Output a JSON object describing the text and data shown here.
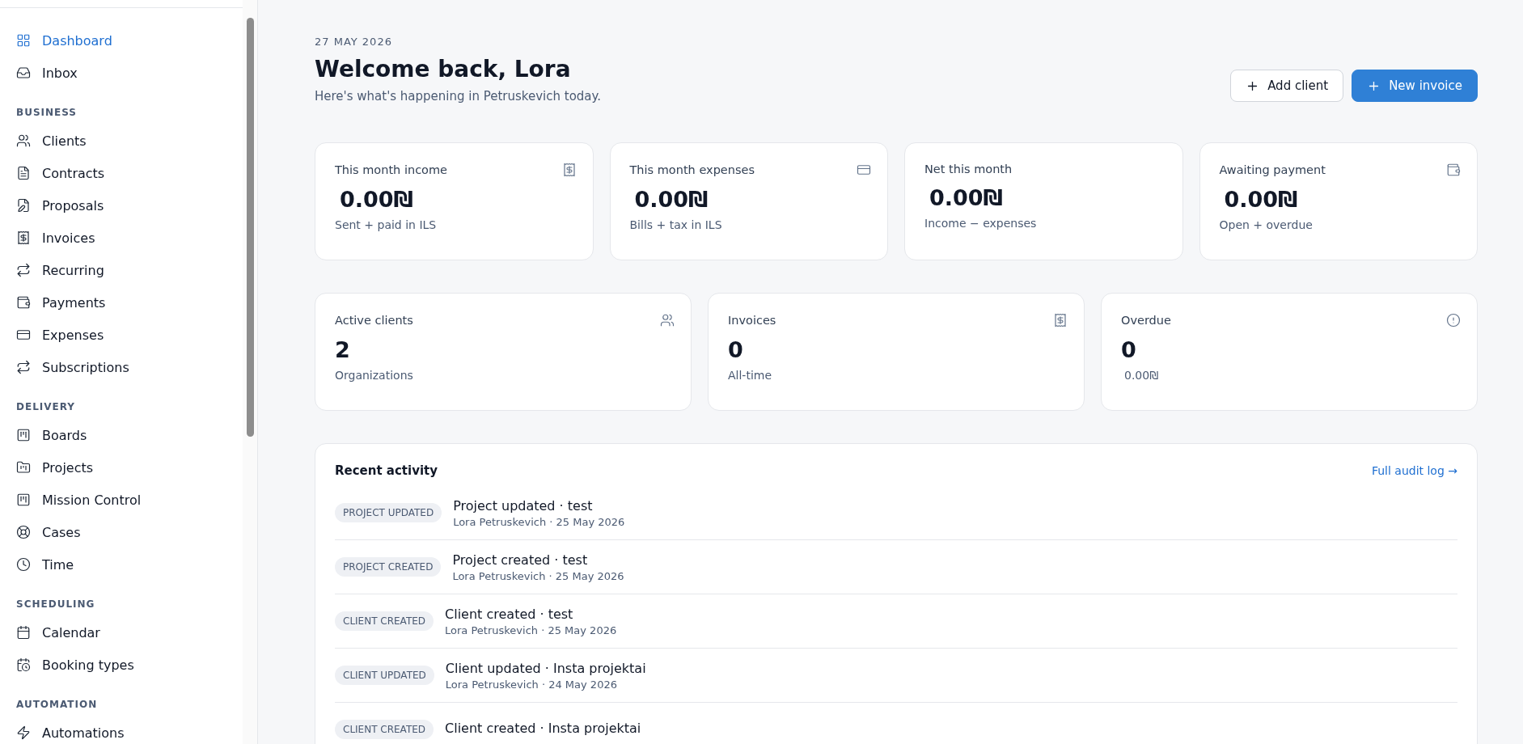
{
  "sidebar": {
    "sections": [
      {
        "items": [
          {
            "label": "Dashboard",
            "selected": true
          },
          {
            "label": "Inbox",
            "selected": false
          }
        ]
      },
      {
        "title": "BUSINESS",
        "items": [
          {
            "label": "Clients",
            "selected": false
          },
          {
            "label": "Contracts",
            "selected": false
          },
          {
            "label": "Proposals",
            "selected": false
          },
          {
            "label": "Invoices",
            "selected": false
          },
          {
            "label": "Recurring",
            "selected": false
          },
          {
            "label": "Payments",
            "selected": false
          },
          {
            "label": "Expenses",
            "selected": false
          },
          {
            "label": "Subscriptions",
            "selected": false
          }
        ]
      },
      {
        "title": "DELIVERY",
        "items": [
          {
            "label": "Boards",
            "selected": false
          },
          {
            "label": "Projects",
            "selected": false
          },
          {
            "label": "Mission Control",
            "selected": false
          },
          {
            "label": "Cases",
            "selected": false
          },
          {
            "label": "Time",
            "selected": false
          }
        ]
      },
      {
        "title": "SCHEDULING",
        "items": [
          {
            "label": "Calendar",
            "selected": false
          },
          {
            "label": "Booking types",
            "selected": false
          }
        ]
      },
      {
        "title": "AUTOMATION",
        "items": [
          {
            "label": "Automations",
            "selected": false
          }
        ]
      }
    ]
  },
  "header": {
    "date": "27 MAY 2026",
    "title": "Welcome back, Lora",
    "subtitle": "Here's what's happening in Petruskevich today.",
    "buttons": [
      {
        "label": "Add client",
        "kind": "secondary"
      },
      {
        "label": "New invoice",
        "kind": "primary"
      }
    ]
  },
  "money_cards": [
    {
      "label": "This month income",
      "value": "0.00₪",
      "note": "Sent + paid in ILS"
    },
    {
      "label": "This month expenses",
      "value": "0.00₪",
      "note": "Bills + tax in ILS"
    },
    {
      "label": "Net this month",
      "value": "0.00₪",
      "note": "Income − expenses"
    },
    {
      "label": "Awaiting payment",
      "value": "0.00₪",
      "note": "Open + overdue"
    }
  ],
  "count_cards": [
    {
      "label": "Active clients",
      "value": "2",
      "note": "Organizations"
    },
    {
      "label": "Invoices",
      "value": "0",
      "note": "All-time"
    },
    {
      "label": "Overdue",
      "value": "0",
      "note": "0.00₪"
    }
  ],
  "activity": {
    "title": "Recent activity",
    "link": "Full audit log →",
    "rows": [
      {
        "tag": "PROJECT UPDATED",
        "title": "Project updated · test",
        "meta": "Lora Petruskevich · 25 May 2026"
      },
      {
        "tag": "PROJECT CREATED",
        "title": "Project created · test",
        "meta": "Lora Petruskevich · 25 May 2026"
      },
      {
        "tag": "CLIENT CREATED",
        "title": "Client created · test",
        "meta": "Lora Petruskevich · 25 May 2026"
      },
      {
        "tag": "CLIENT UPDATED",
        "title": "Client updated · Insta projektai",
        "meta": "Lora Petruskevich · 24 May 2026"
      },
      {
        "tag": "CLIENT CREATED",
        "title": "Client created · Insta projektai"
      }
    ]
  }
}
